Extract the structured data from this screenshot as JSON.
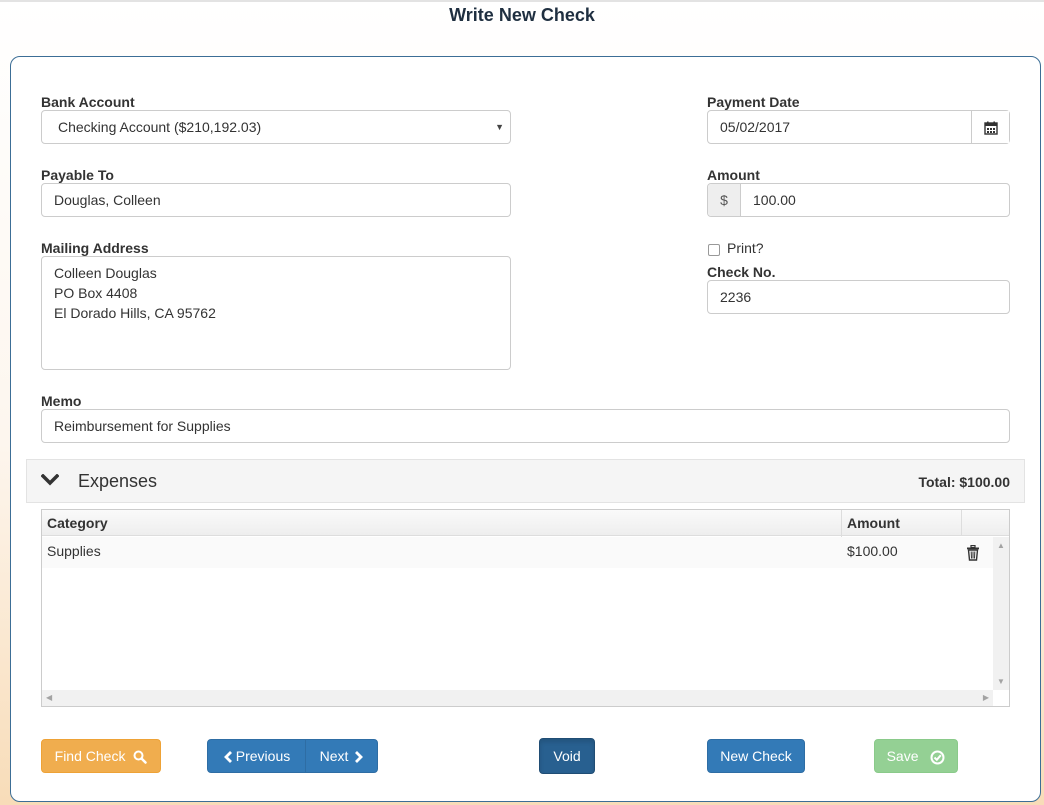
{
  "page": {
    "title": "Write New Check"
  },
  "form": {
    "bank_account": {
      "label": "Bank Account",
      "value": "Checking Account ($210,192.03)"
    },
    "payment_date": {
      "label": "Payment Date",
      "value": "05/02/2017"
    },
    "payable_to": {
      "label": "Payable To",
      "value": "Douglas, Colleen"
    },
    "amount": {
      "label": "Amount",
      "currency_symbol": "$",
      "value": "100.00"
    },
    "mailing_address": {
      "label": "Mailing Address",
      "lines": [
        "Colleen Douglas",
        "PO Box 4408",
        "El Dorado Hills, CA 95762"
      ]
    },
    "print": {
      "label": "Print?",
      "checked": false
    },
    "check_no": {
      "label": "Check No.",
      "value": "2236"
    },
    "memo": {
      "label": "Memo",
      "value": "Reimbursement for Supplies"
    }
  },
  "expenses": {
    "title": "Expenses",
    "total_label": "Total: $100.00",
    "columns": [
      "Category",
      "Amount"
    ],
    "rows": [
      {
        "category": "Supplies",
        "amount": "$100.00"
      }
    ]
  },
  "actions": {
    "find_check": "Find Check",
    "previous": "Previous",
    "next": "Next",
    "void": "Void",
    "new_check": "New Check",
    "save": "Save"
  },
  "colors": {
    "warning": "#f0ad4e",
    "primary": "#337ab7",
    "success": "#5cb85c",
    "panel_border": "#3c6e96"
  },
  "icons": [
    "calendar-icon",
    "chevron-down-icon",
    "trash-icon",
    "search-icon",
    "chevron-left-icon",
    "chevron-right-icon",
    "check-circle-icon"
  ]
}
